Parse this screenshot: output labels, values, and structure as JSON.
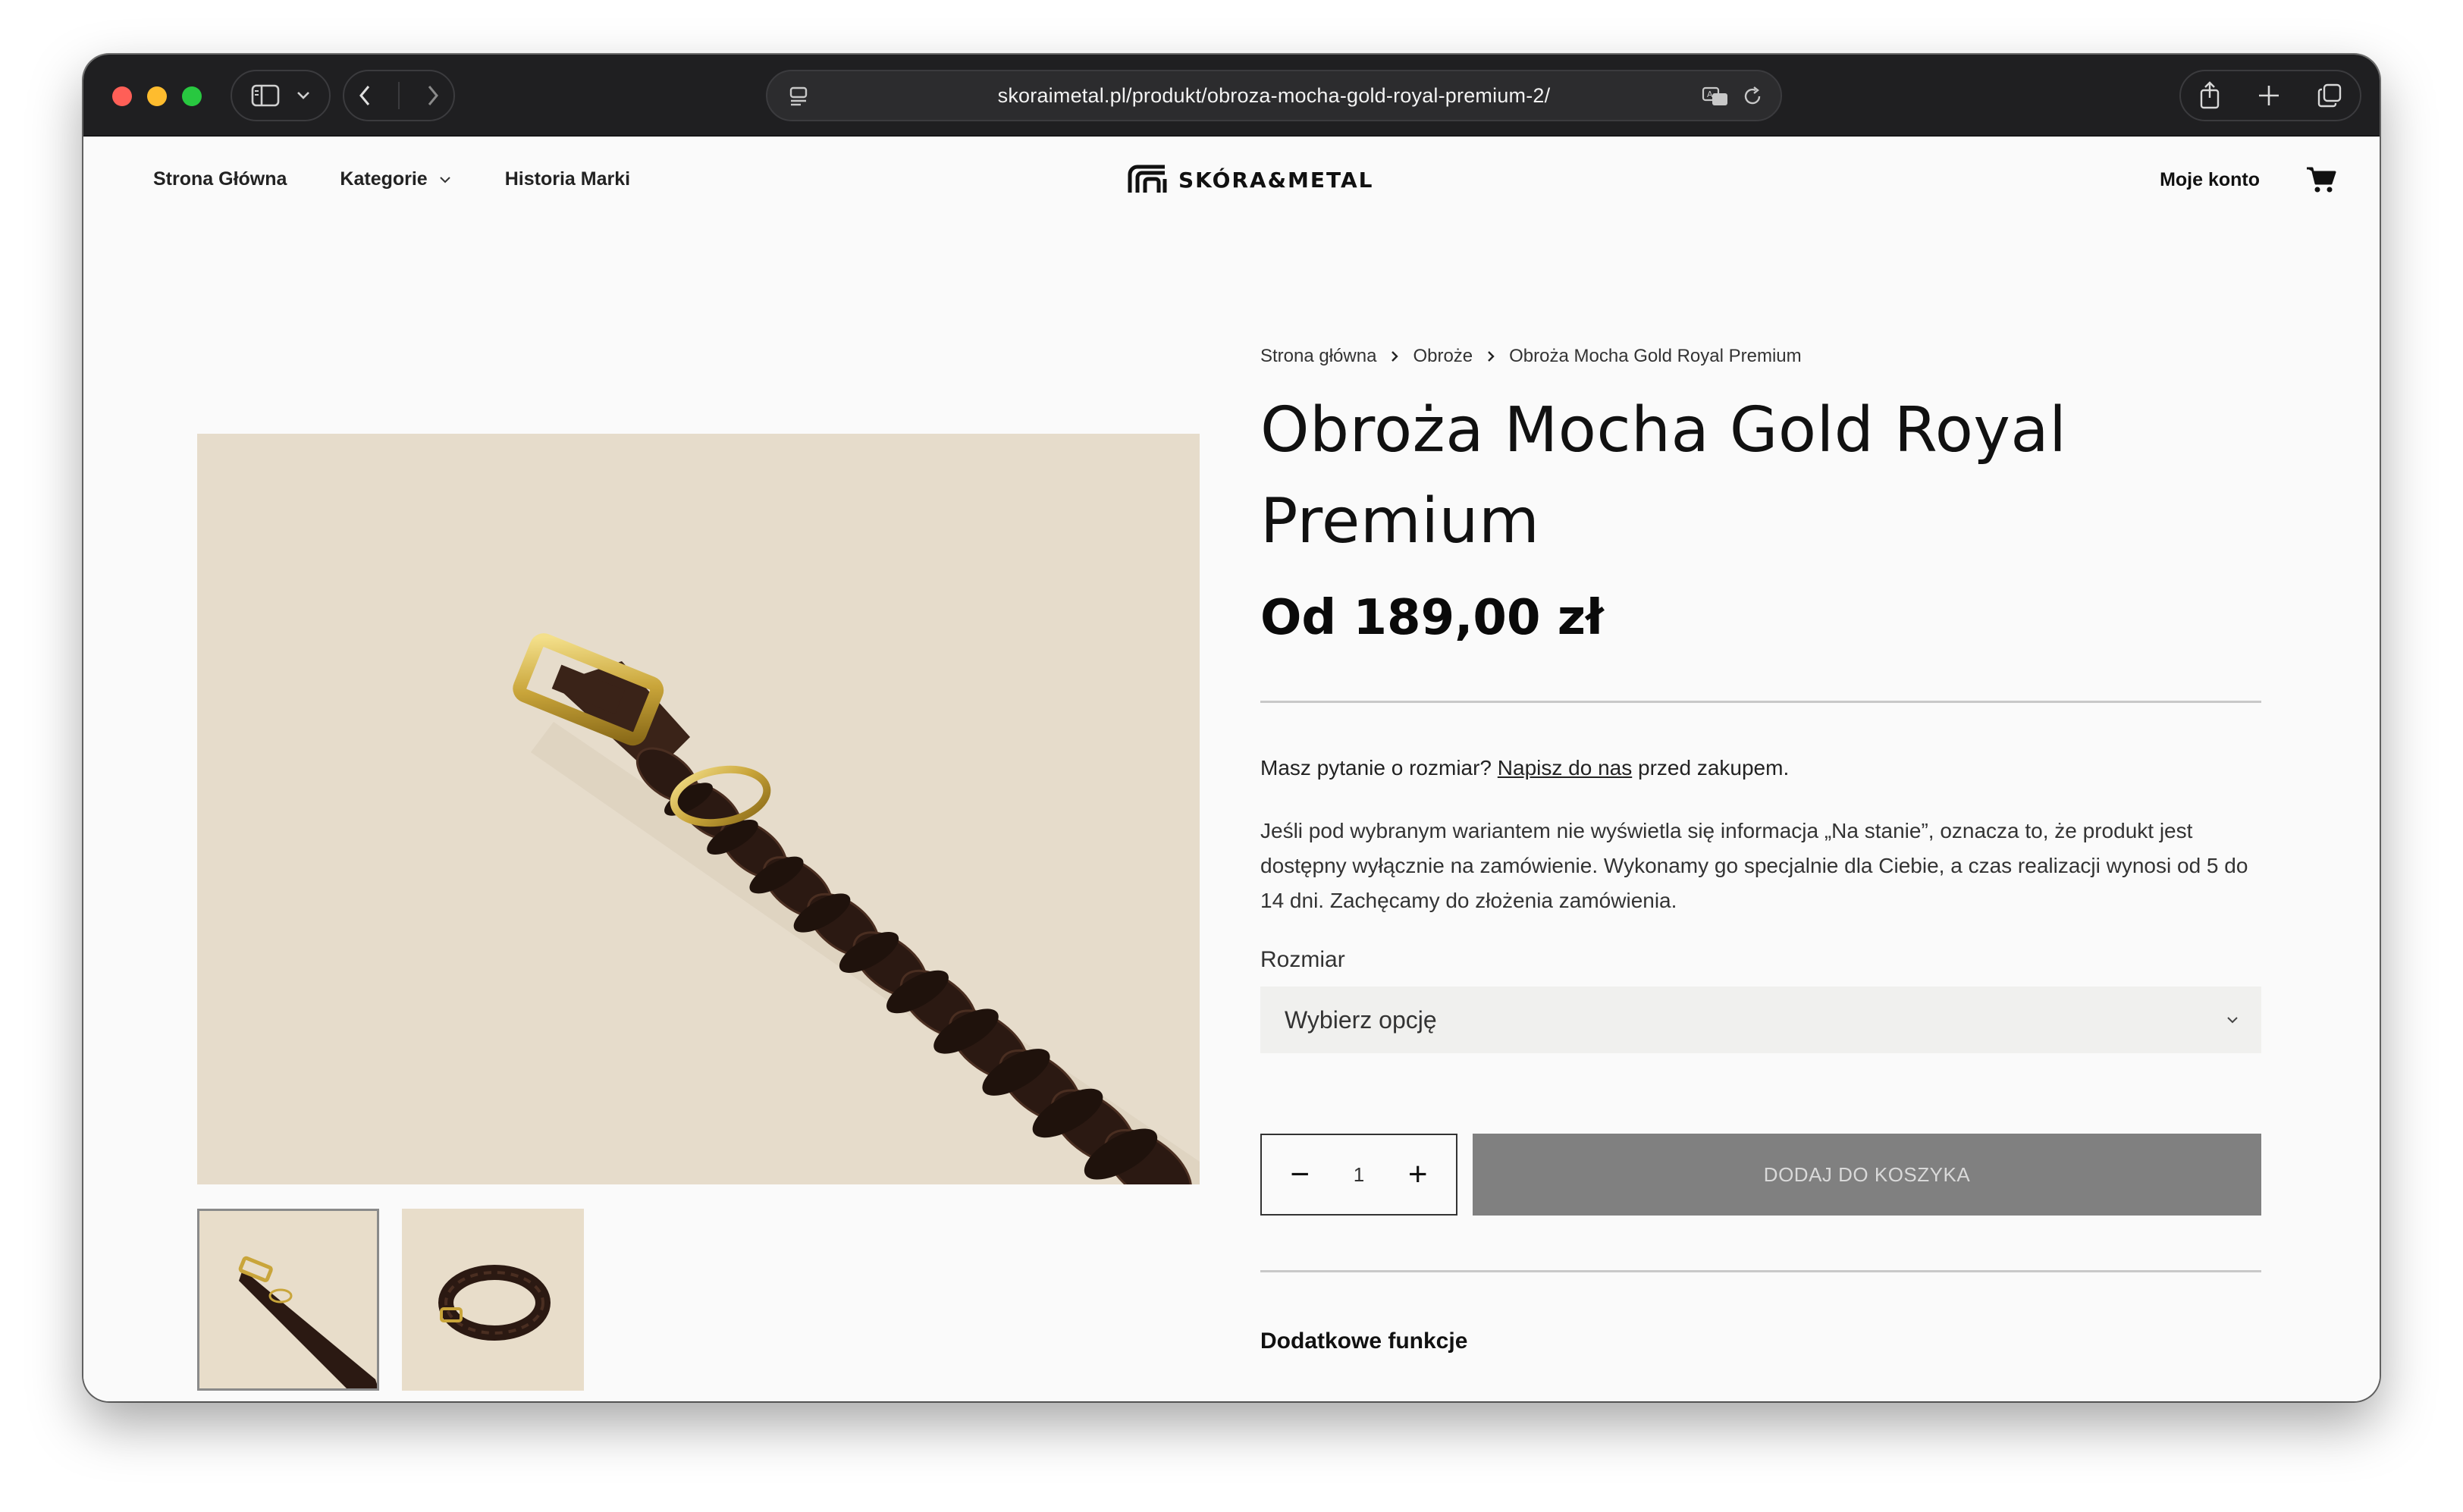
{
  "browser": {
    "url": "skoraimetal.pl/produkt/obroza-mocha-gold-royal-premium-2/"
  },
  "header": {
    "nav": {
      "home": "Strona Główna",
      "categories": "Kategorie",
      "history": "Historia Marki"
    },
    "logo_text": "SKÓRA&METAL",
    "account": "Moje konto"
  },
  "breadcrumb": {
    "home": "Strona główna",
    "category": "Obroże",
    "current": "Obroża Mocha Gold Royal Premium"
  },
  "product": {
    "title_line1": "Obroża Mocha Gold Royal",
    "title_line2": "Premium",
    "price": "Od 189,00 zł",
    "question_prefix": "Masz pytanie o rozmiar?",
    "question_link": "Napisz do nas",
    "question_suffix": "przed zakupem.",
    "description": "Jeśli pod wybranym wariantem nie wyświetla się informacja „Na stanie”, oznacza to, że produkt jest dostępny wyłącznie na zamówienie. Wykonamy go specjalnie dla Ciebie, a czas realizacji wynosi od 5 do 14 dni. Zachęcamy do złożenia zamówienia.",
    "size_label": "Rozmiar",
    "size_select": "Wybierz opcję",
    "quantity": "1",
    "qty_minus": "−",
    "qty_plus": "+",
    "add_to_cart": "DODAJ DO KOSZYKA",
    "extra_features": "Dodatkowe funkcje"
  },
  "colors": {
    "image_bg": "#e6dccb",
    "button_disabled": "#808080",
    "chrome": "#1f1f21"
  }
}
